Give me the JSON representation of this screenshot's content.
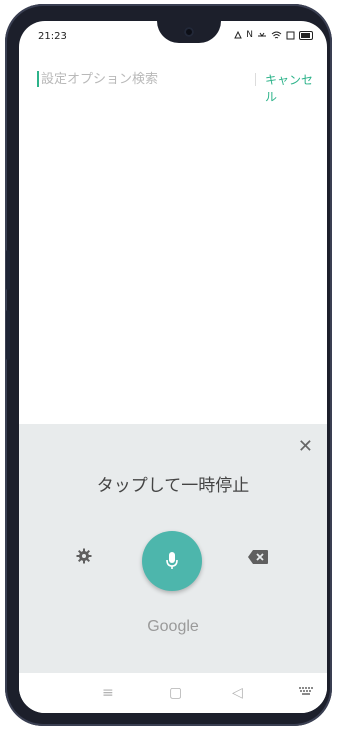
{
  "status_bar": {
    "time": "21:23",
    "icons": [
      "alarm-icon",
      "nfc-icon",
      "data-icon",
      "wifi-icon",
      "screenshot-icon",
      "battery-icon"
    ]
  },
  "search": {
    "placeholder": "設定オプション検索",
    "value": "",
    "cancel_label": "キャンセル"
  },
  "voice": {
    "prompt": "タップして一時停止",
    "brand": "Google",
    "close_symbol": "✕"
  },
  "colors": {
    "accent": "#2db38a",
    "mic": "#4db6ac",
    "panel_bg": "#e8ebec"
  },
  "nav": {
    "menu_symbol": "≡",
    "home_symbol": "▢",
    "back_symbol": "◁"
  }
}
